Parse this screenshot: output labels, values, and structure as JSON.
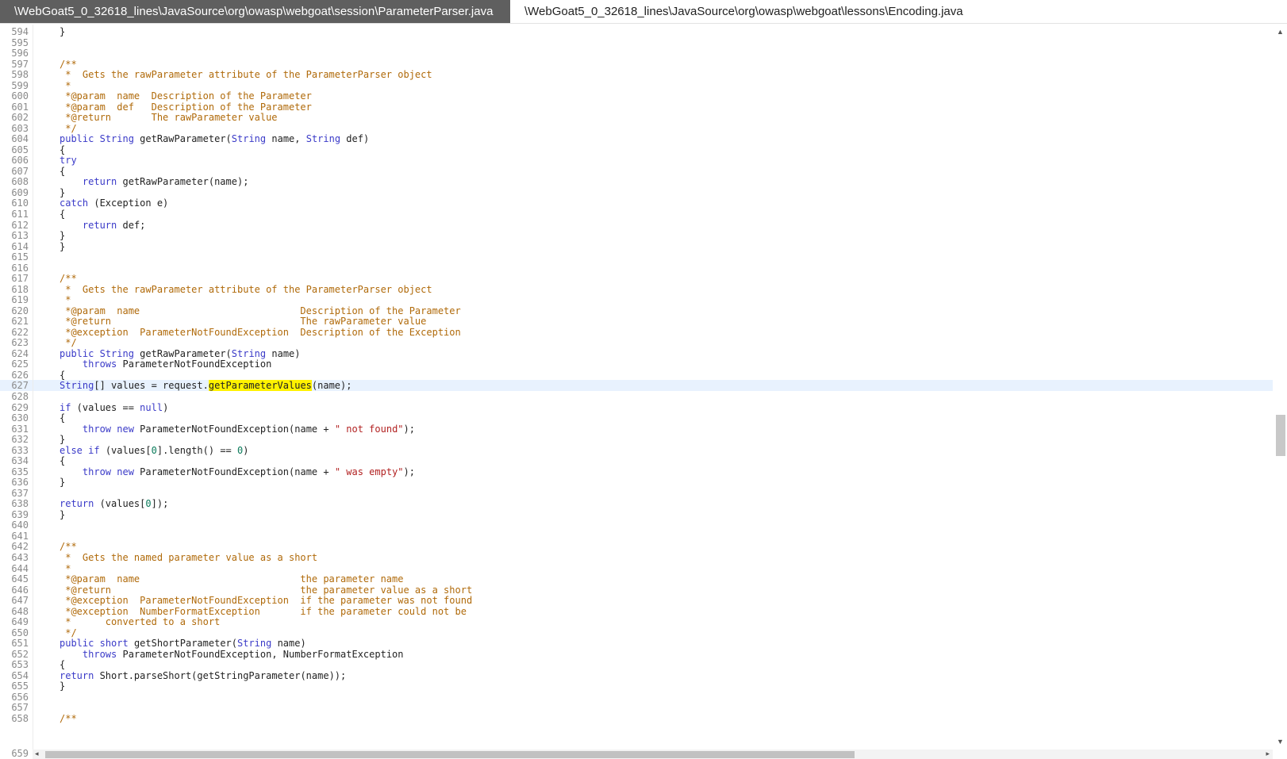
{
  "tabs": [
    {
      "label": "\\WebGoat5_0_32618_lines\\JavaSource\\org\\owasp\\webgoat\\session\\ParameterParser.java",
      "active": true
    },
    {
      "label": "\\WebGoat5_0_32618_lines\\JavaSource\\org\\owasp\\webgoat\\lessons\\Encoding.java",
      "active": false
    }
  ],
  "first_line": 594,
  "current_line": 627,
  "last_line_label": "659",
  "highlight": "getParameterValues",
  "lines": [
    "    }",
    "",
    "",
    "    /**",
    "     *  Gets the rawParameter attribute of the ParameterParser object",
    "     *",
    "     *@param  name  Description of the Parameter",
    "     *@param  def   Description of the Parameter",
    "     *@return       The rawParameter value",
    "     */",
    "    public String getRawParameter(String name, String def)",
    "    {",
    "    try",
    "    {",
    "        return getRawParameter(name);",
    "    }",
    "    catch (Exception e)",
    "    {",
    "        return def;",
    "    }",
    "    }",
    "",
    "",
    "    /**",
    "     *  Gets the rawParameter attribute of the ParameterParser object",
    "     *",
    "     *@param  name                            Description of the Parameter",
    "     *@return                                 The rawParameter value",
    "     *@exception  ParameterNotFoundException  Description of the Exception",
    "     */",
    "    public String getRawParameter(String name)",
    "        throws ParameterNotFoundException",
    "    {",
    "    String[] values = request.getParameterValues(name);",
    "",
    "    if (values == null)",
    "    {",
    "        throw new ParameterNotFoundException(name + \" not found\");",
    "    }",
    "    else if (values[0].length() == 0)",
    "    {",
    "        throw new ParameterNotFoundException(name + \" was empty\");",
    "    }",
    "",
    "    return (values[0]);",
    "    }",
    "",
    "",
    "    /**",
    "     *  Gets the named parameter value as a short",
    "     *",
    "     *@param  name                            the parameter name",
    "     *@return                                 the parameter value as a short",
    "     *@exception  ParameterNotFoundException  if the parameter was not found",
    "     *@exception  NumberFormatException       if the parameter could not be",
    "     *      converted to a short",
    "     */",
    "    public short getShortParameter(String name)",
    "        throws ParameterNotFoundException, NumberFormatException",
    "    {",
    "    return Short.parseShort(getStringParameter(name));",
    "    }",
    "",
    "",
    "    /**"
  ],
  "scroll": {
    "vertical_position": 0.55,
    "horizontal_position": 0.0
  },
  "colors": {
    "active_tab_bg": "#5f5f5f",
    "keyword": "#3a3ac8",
    "comment": "#b06a0a",
    "string": "#b22222",
    "highlight": "#fff200",
    "current_line_bg": "#e8f2fe"
  }
}
